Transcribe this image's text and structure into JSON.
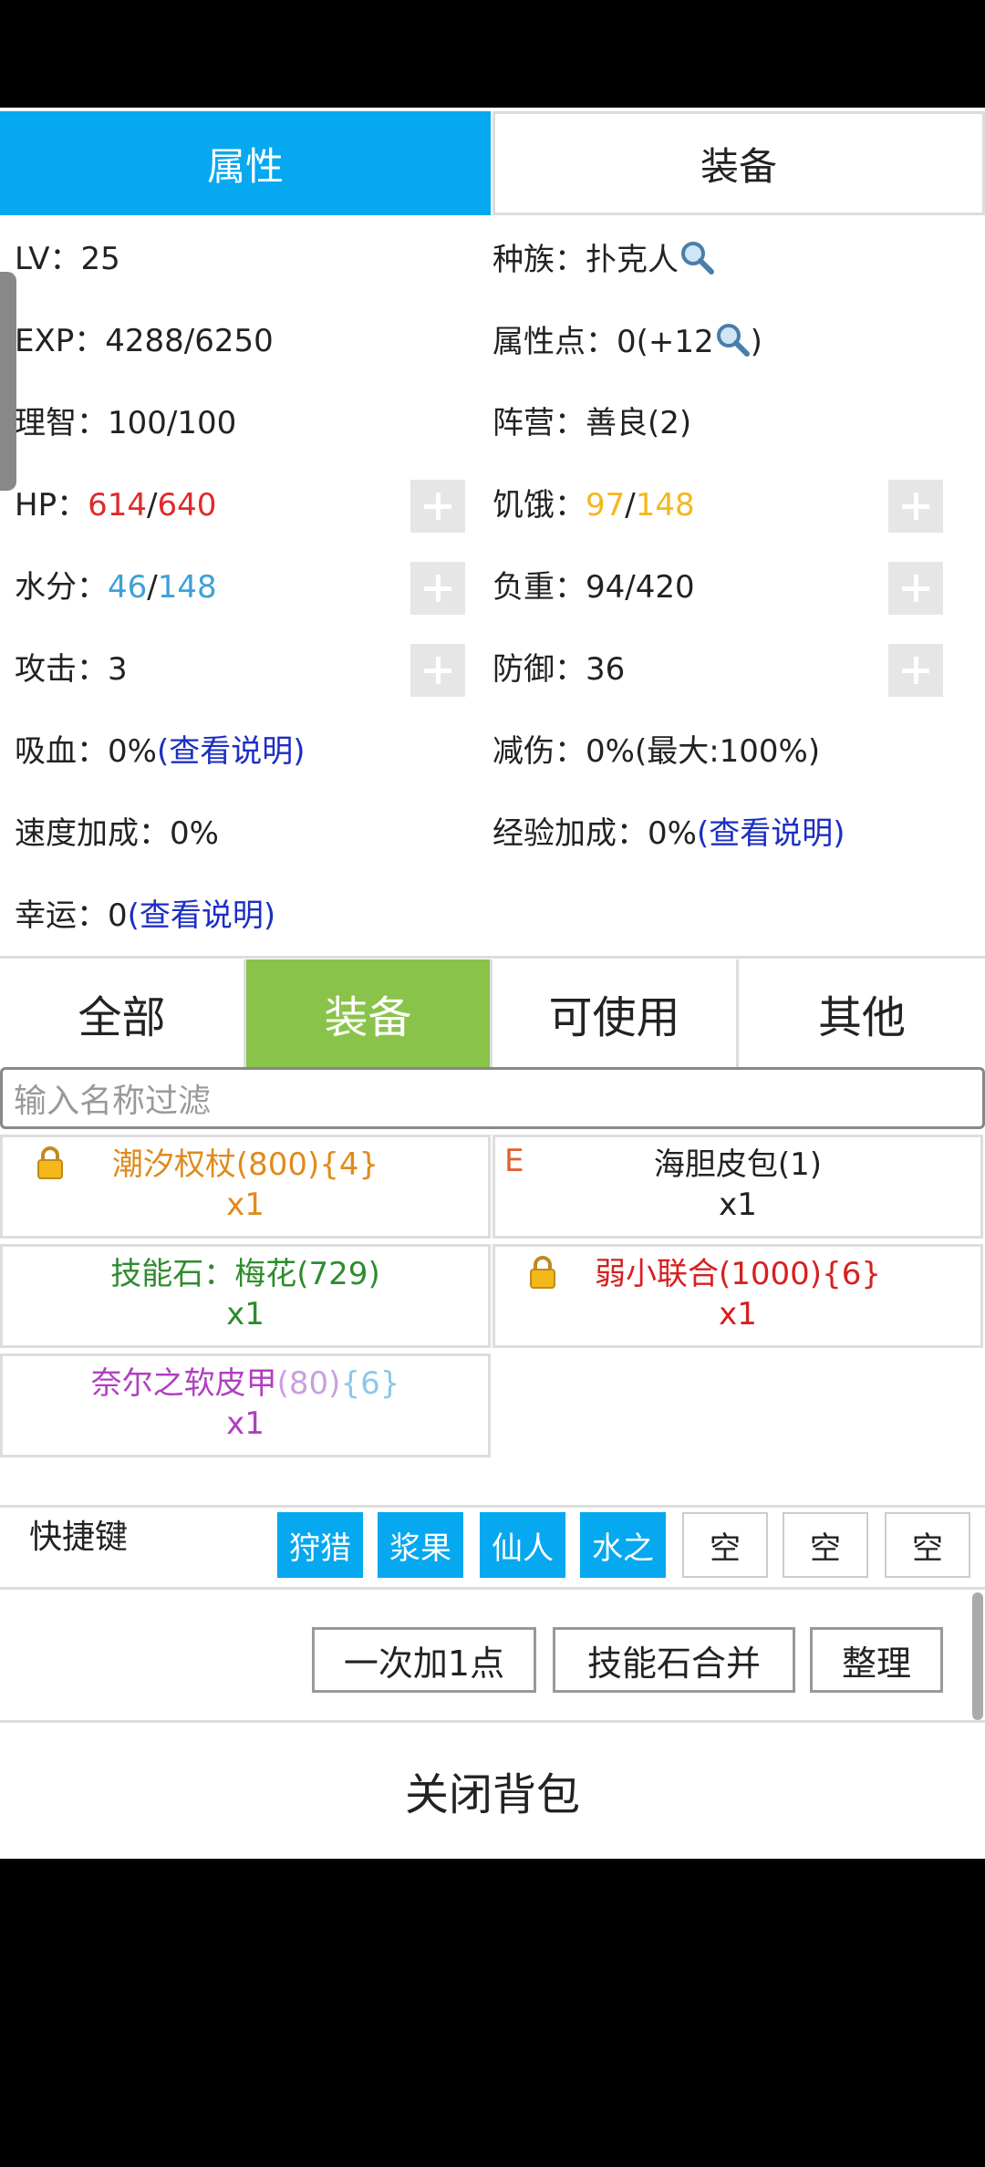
{
  "tabs": {
    "attributes": "属性",
    "equipment": "装备"
  },
  "stats": {
    "lv_label": "LV：",
    "lv_value": "25",
    "race_label": "种族：",
    "race_value": "扑克人",
    "exp_label": "EXP：",
    "exp_value": "4288/6250",
    "attr_points_label": "属性点：",
    "attr_points_value": "0(+12",
    "attr_points_close": ")",
    "sanity_label": "理智：",
    "sanity_value": "100/100",
    "faction_label": "阵营：",
    "faction_value": "善良(2)",
    "hp_label": "HP：",
    "hp_current": "614",
    "hp_max": "640",
    "hunger_label": "饥饿：",
    "hunger_current": "97",
    "hunger_max": "148",
    "water_label": "水分：",
    "water_current": "46",
    "water_max": "148",
    "load_label": "负重：",
    "load_value": "94/420",
    "attack_label": "攻击：",
    "attack_value": "3",
    "defense_label": "防御：",
    "defense_value": "36",
    "lifesteal_label": "吸血：",
    "lifesteal_value": "0%",
    "damage_reduction_label": "减伤：",
    "damage_reduction_value": "0%(最大:100%)",
    "speed_bonus_label": "速度加成：",
    "speed_bonus_value": "0%",
    "exp_bonus_label": "经验加成：",
    "exp_bonus_value": "0%",
    "luck_label": "幸运：",
    "luck_value": "0",
    "view_explanation": "(查看说明)",
    "separator": "/"
  },
  "categories": [
    "全部",
    "装备",
    "可使用",
    "其他"
  ],
  "filter": {
    "placeholder": "输入名称过滤"
  },
  "items": [
    {
      "name": "潮汐权杖(800){4}",
      "qty": "x1",
      "locked": true,
      "color": "#e08a1c"
    },
    {
      "name": "海胆皮包(1)",
      "qty": "x1",
      "marker": "E",
      "color": "#222222"
    },
    {
      "name": "技能石：梅花(729)",
      "qty": "x1",
      "color": "#2e8c2e"
    },
    {
      "name": "弱小联合(1000){6}",
      "qty": "x1",
      "locked": true,
      "color": "#d62020"
    },
    {
      "name_a": "奈尔之软皮甲",
      "name_b": "(80)",
      "name_c": "{6}",
      "qty": "x1",
      "color": "#b040c0"
    }
  ],
  "shortcuts": {
    "label": "快捷键",
    "slots": [
      "狩猎",
      "浆果",
      "仙人",
      "水之",
      "空",
      "空",
      "空"
    ]
  },
  "actions": {
    "add_one": "一次加1点",
    "merge_stones": "技能石合并",
    "sort": "整理"
  },
  "close_label": "关闭背包",
  "colors": {
    "tab_active": "#06a8f0",
    "category_active": "#8ac34a",
    "hp": "#e02a2a",
    "hunger": "#f2b81c",
    "water": "#3ea0da",
    "link": "#1c2ec4"
  }
}
